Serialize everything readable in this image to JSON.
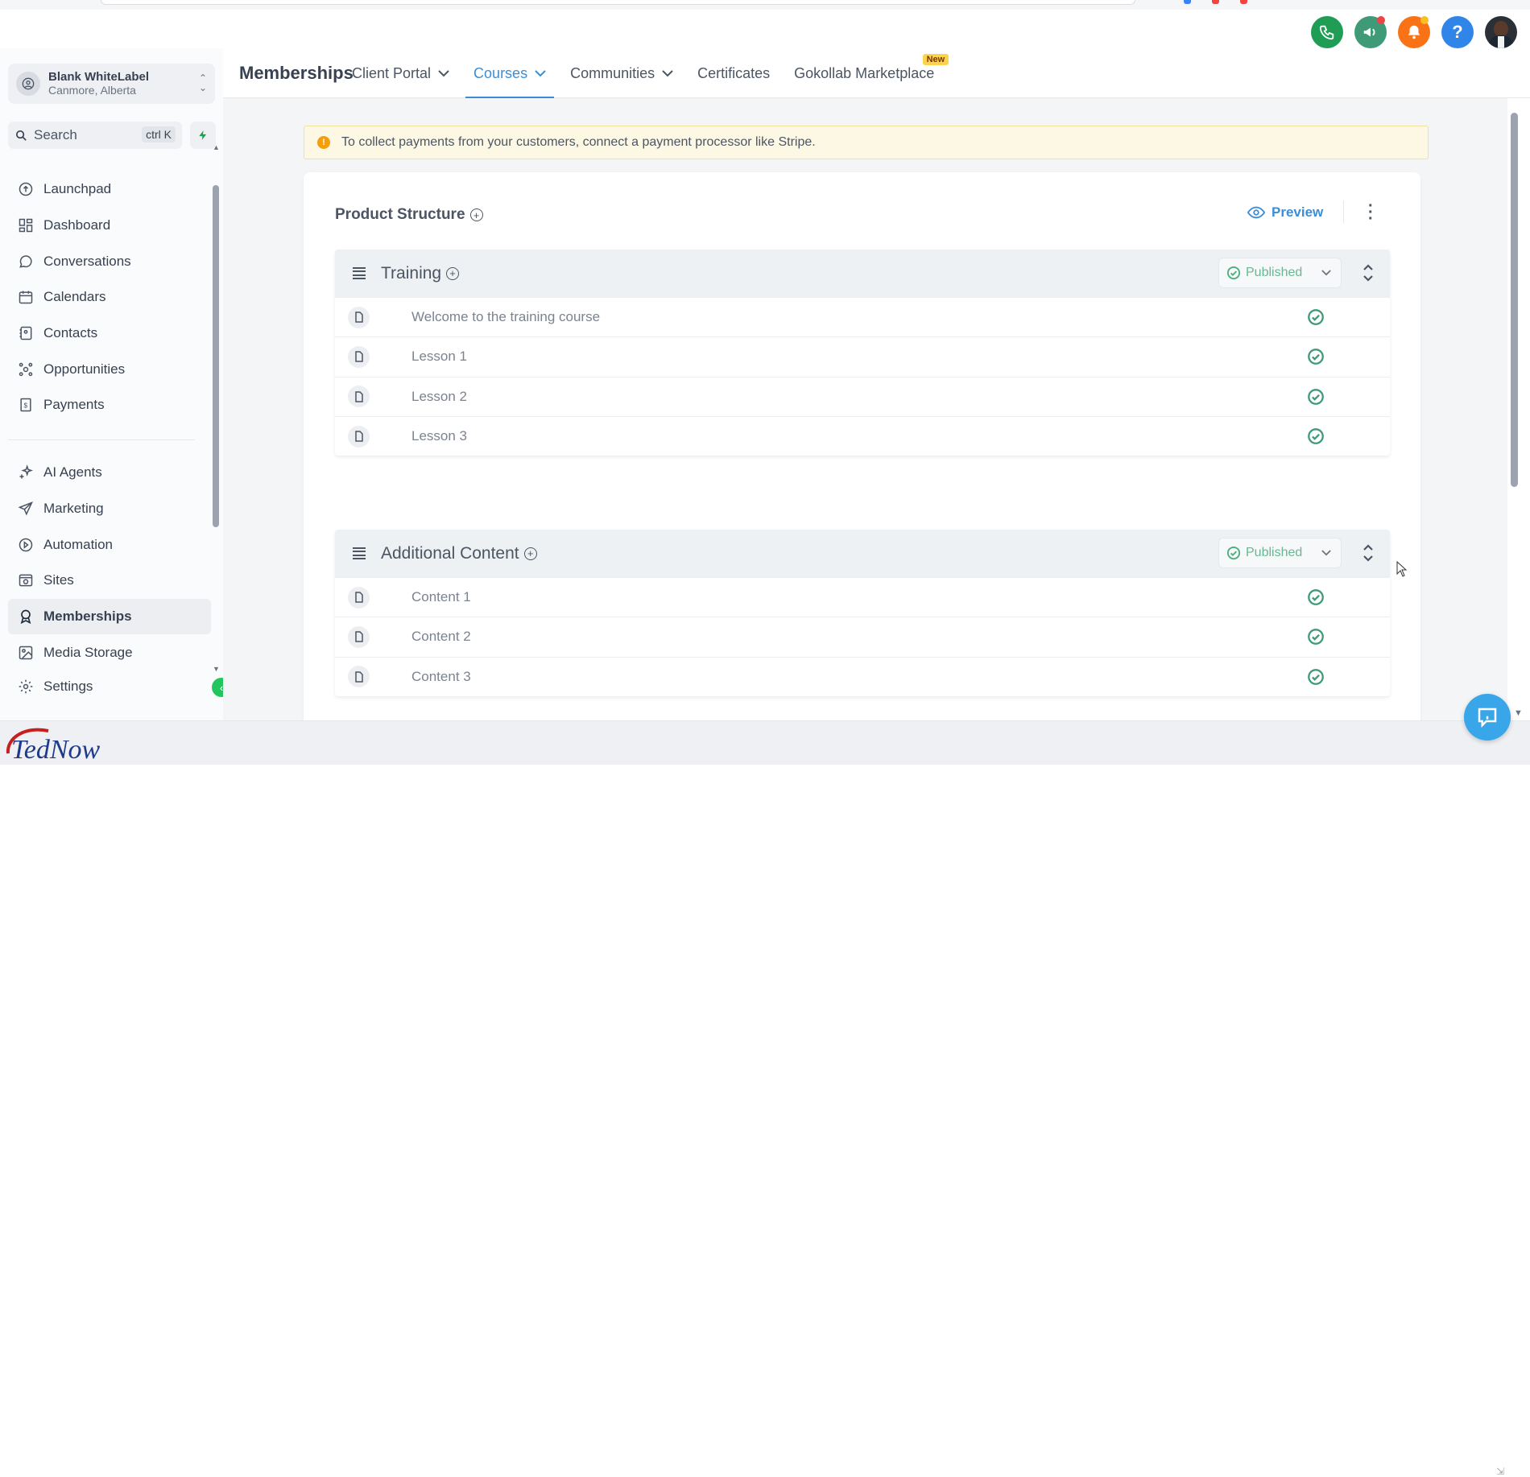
{
  "header": {
    "icons": [
      {
        "name": "phone-icon",
        "color": "#1f9d55"
      },
      {
        "name": "megaphone-icon",
        "color": "#3f9a78",
        "dot": "#ef4444"
      },
      {
        "name": "bell-icon",
        "color": "#f97316",
        "dot": "#fbbf24"
      },
      {
        "name": "help-icon",
        "color": "#2f86e8"
      }
    ]
  },
  "sidebar": {
    "account": {
      "name": "Blank WhiteLabel",
      "location": "Canmore, Alberta"
    },
    "search": {
      "label": "Search",
      "shortcut": "ctrl K"
    },
    "items_top": [
      {
        "label": "Launchpad",
        "icon": "launchpad-icon"
      },
      {
        "label": "Dashboard",
        "icon": "dashboard-icon"
      },
      {
        "label": "Conversations",
        "icon": "chat-icon"
      },
      {
        "label": "Calendars",
        "icon": "calendar-icon"
      },
      {
        "label": "Contacts",
        "icon": "contacts-icon"
      },
      {
        "label": "Opportunities",
        "icon": "opportunities-icon"
      },
      {
        "label": "Payments",
        "icon": "payments-icon"
      }
    ],
    "items_bottom": [
      {
        "label": "AI Agents",
        "icon": "sparkle-icon"
      },
      {
        "label": "Marketing",
        "icon": "send-icon"
      },
      {
        "label": "Automation",
        "icon": "automation-icon"
      },
      {
        "label": "Sites",
        "icon": "sites-icon"
      },
      {
        "label": "Memberships",
        "icon": "award-icon",
        "active": true
      },
      {
        "label": "Media Storage",
        "icon": "image-icon"
      },
      {
        "label": "Settings",
        "icon": "gear-icon"
      }
    ]
  },
  "topnav": {
    "title": "Memberships",
    "tabs": [
      {
        "label": "Client Portal",
        "dropdown": true
      },
      {
        "label": "Courses",
        "dropdown": true,
        "active": true
      },
      {
        "label": "Communities",
        "dropdown": true
      },
      {
        "label": "Certificates",
        "dropdown": false
      },
      {
        "label": "Gokollab Marketplace",
        "dropdown": false,
        "badge": "New"
      }
    ]
  },
  "alert": {
    "text": "To collect payments from your customers, connect a payment processor like Stripe."
  },
  "product": {
    "title": "Product Structure",
    "preview_label": "Preview",
    "sections": [
      {
        "title": "Training",
        "status": "Published",
        "lessons": [
          "Welcome to the training course",
          "Lesson 1",
          "Lesson 2",
          "Lesson 3"
        ]
      },
      {
        "title": "Additional Content",
        "status": "Published",
        "lessons": [
          "Content 1",
          "Content 2",
          "Content 3"
        ]
      }
    ]
  },
  "footer": {
    "logo_text": "TedNow"
  },
  "colors": {
    "accent": "#3b8ed6",
    "published": "#68b891",
    "alert_bg": "#fdf8e4"
  }
}
